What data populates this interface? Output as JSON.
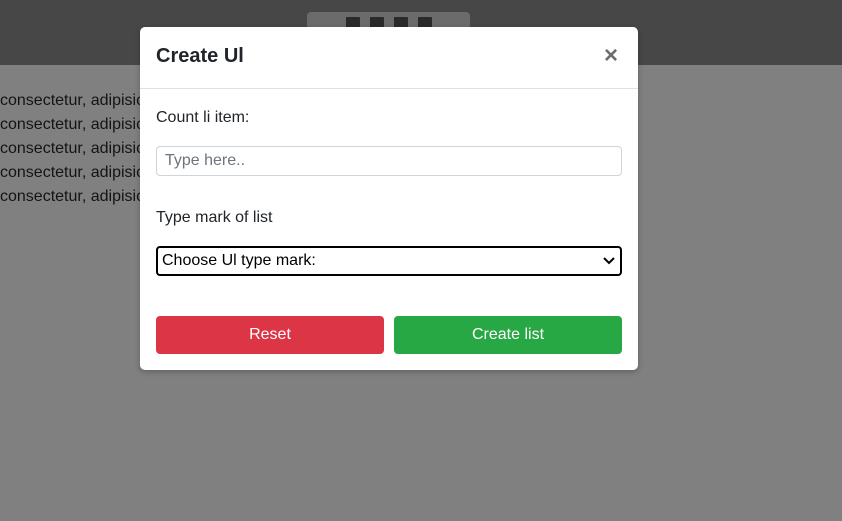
{
  "background": {
    "lines": [
      "consectetur, adipisicing elit.",
      "consectetur, adipisicing elit.",
      "consectetur, adipisicing elit.",
      "consectetur, adipisicing elit.",
      "consectetur, adipisicing elit."
    ],
    "toolbar_icons": [
      "document-icon",
      "bold-icon",
      "align-icon",
      "list-icon"
    ]
  },
  "modal": {
    "title": "Create Ul",
    "close_label": "×",
    "count_label": "Count li item:",
    "count_placeholder": "Type here..",
    "count_value": "",
    "mark_label": "Type mark of list",
    "mark_select_value": "Choose Ul type mark:",
    "reset_label": "Reset",
    "create_label": "Create list"
  },
  "colors": {
    "overlay": "#808080",
    "reset": "#dc3545",
    "create": "#28a745"
  }
}
